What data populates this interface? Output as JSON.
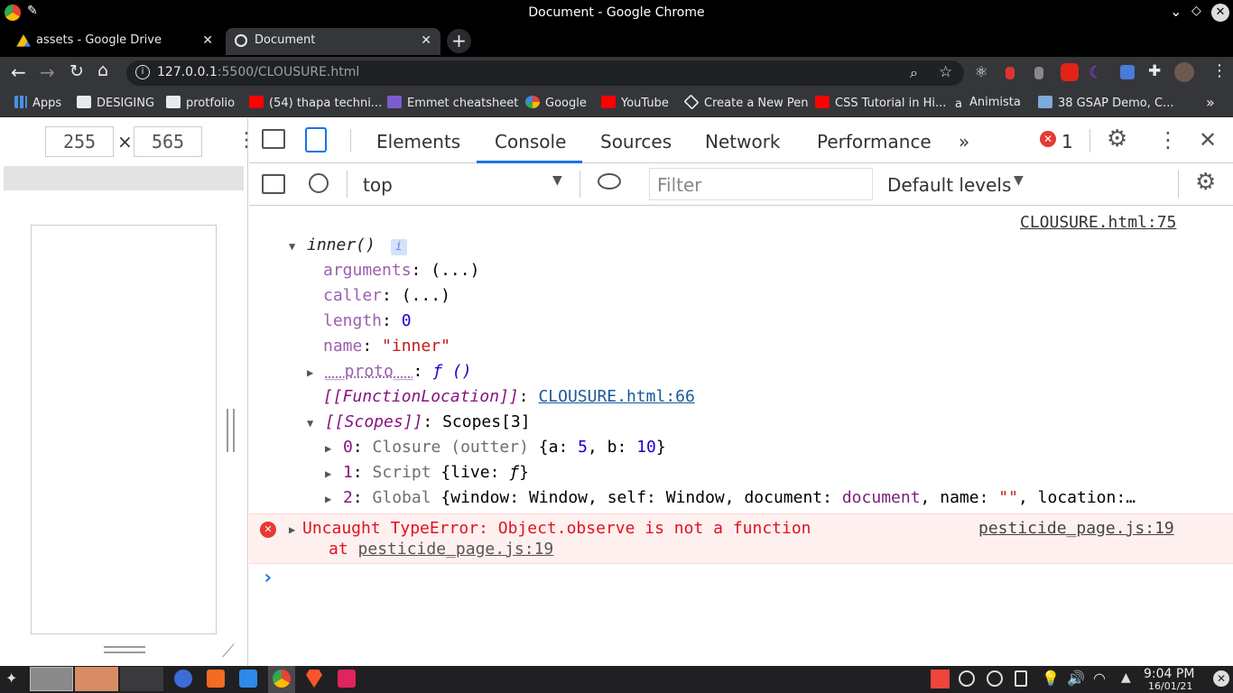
{
  "window": {
    "title": "Document - Google Chrome"
  },
  "tabs": [
    {
      "label": "assets - Google Drive",
      "active": false
    },
    {
      "label": "Document",
      "active": true
    }
  ],
  "address": {
    "host": "127.0.0.1",
    "path": ":5500/CLOUSURE.html"
  },
  "bookmarks": [
    {
      "label": "Apps",
      "icon": "apps-grid-icon"
    },
    {
      "label": "DESIGING",
      "icon": "folder-icon"
    },
    {
      "label": "protfolio",
      "icon": "folder-icon"
    },
    {
      "label": "(54) thapa techni...",
      "icon": "youtube-icon"
    },
    {
      "label": "Emmet cheatsheet",
      "icon": "emmet-icon"
    },
    {
      "label": "Google",
      "icon": "google-icon"
    },
    {
      "label": "YouTube",
      "icon": "youtube-icon"
    },
    {
      "label": "Create a New Pen",
      "icon": "codepen-icon"
    },
    {
      "label": "CSS Tutorial in Hi...",
      "icon": "youtube-icon"
    },
    {
      "label": "Animista",
      "icon": "animista-icon"
    },
    {
      "label": "38 GSAP Demo, C...",
      "icon": "gsap-icon"
    }
  ],
  "device": {
    "width": "255",
    "height": "565",
    "times": "×"
  },
  "devtools": {
    "tabs": [
      "Elements",
      "Console",
      "Sources",
      "Network",
      "Performance"
    ],
    "active_tab": "Console",
    "more": "»",
    "error_count": "1",
    "context": "top",
    "filter_placeholder": "Filter",
    "levels": "Default levels"
  },
  "console": {
    "source1": "CLOUSURE.html:75",
    "fn_name": "inner()",
    "info_badge": "i",
    "props": [
      {
        "key": "arguments",
        "value": "(...)"
      },
      {
        "key": "caller",
        "value": "(...)"
      },
      {
        "key": "length",
        "value": "0"
      },
      {
        "key": "name",
        "value": "\"inner\""
      }
    ],
    "proto_key": "__proto__",
    "proto_value": "ƒ ()",
    "fnloc_key": "[[FunctionLocation]]",
    "fnloc_value": "CLOUSURE.html:66",
    "scopes_key": "[[Scopes]]",
    "scopes_value": "Scopes[3]",
    "scope0": {
      "idx": "0",
      "kind": "Closure (outter)",
      "a_key": "a",
      "a_val": "5",
      "b_key": "b",
      "b_val": "10"
    },
    "scope1": {
      "idx": "1",
      "kind": "Script",
      "live_key": "live",
      "live_val": "ƒ"
    },
    "scope2": {
      "idx": "2",
      "kind": "Global",
      "w_key": "window",
      "w_val": "Window",
      "s_key": "self",
      "s_val": "Window",
      "d_key": "document",
      "d_val": "document",
      "n_key": "name",
      "n_val": "\"\"",
      "l_key": "location",
      "tail": ":…"
    },
    "error_message": "Uncaught TypeError: Object.observe is not a function",
    "error_at": "at",
    "error_loc": "pesticide_page.js:19",
    "error_source": "pesticide_page.js:19",
    "prompt": "›"
  },
  "taskbar": {
    "time": "9:04 PM",
    "date": "16/01/21"
  },
  "colors": {
    "accent": "#1a73e8",
    "error_bg": "#fff0f0",
    "error_text": "#c41a16"
  }
}
